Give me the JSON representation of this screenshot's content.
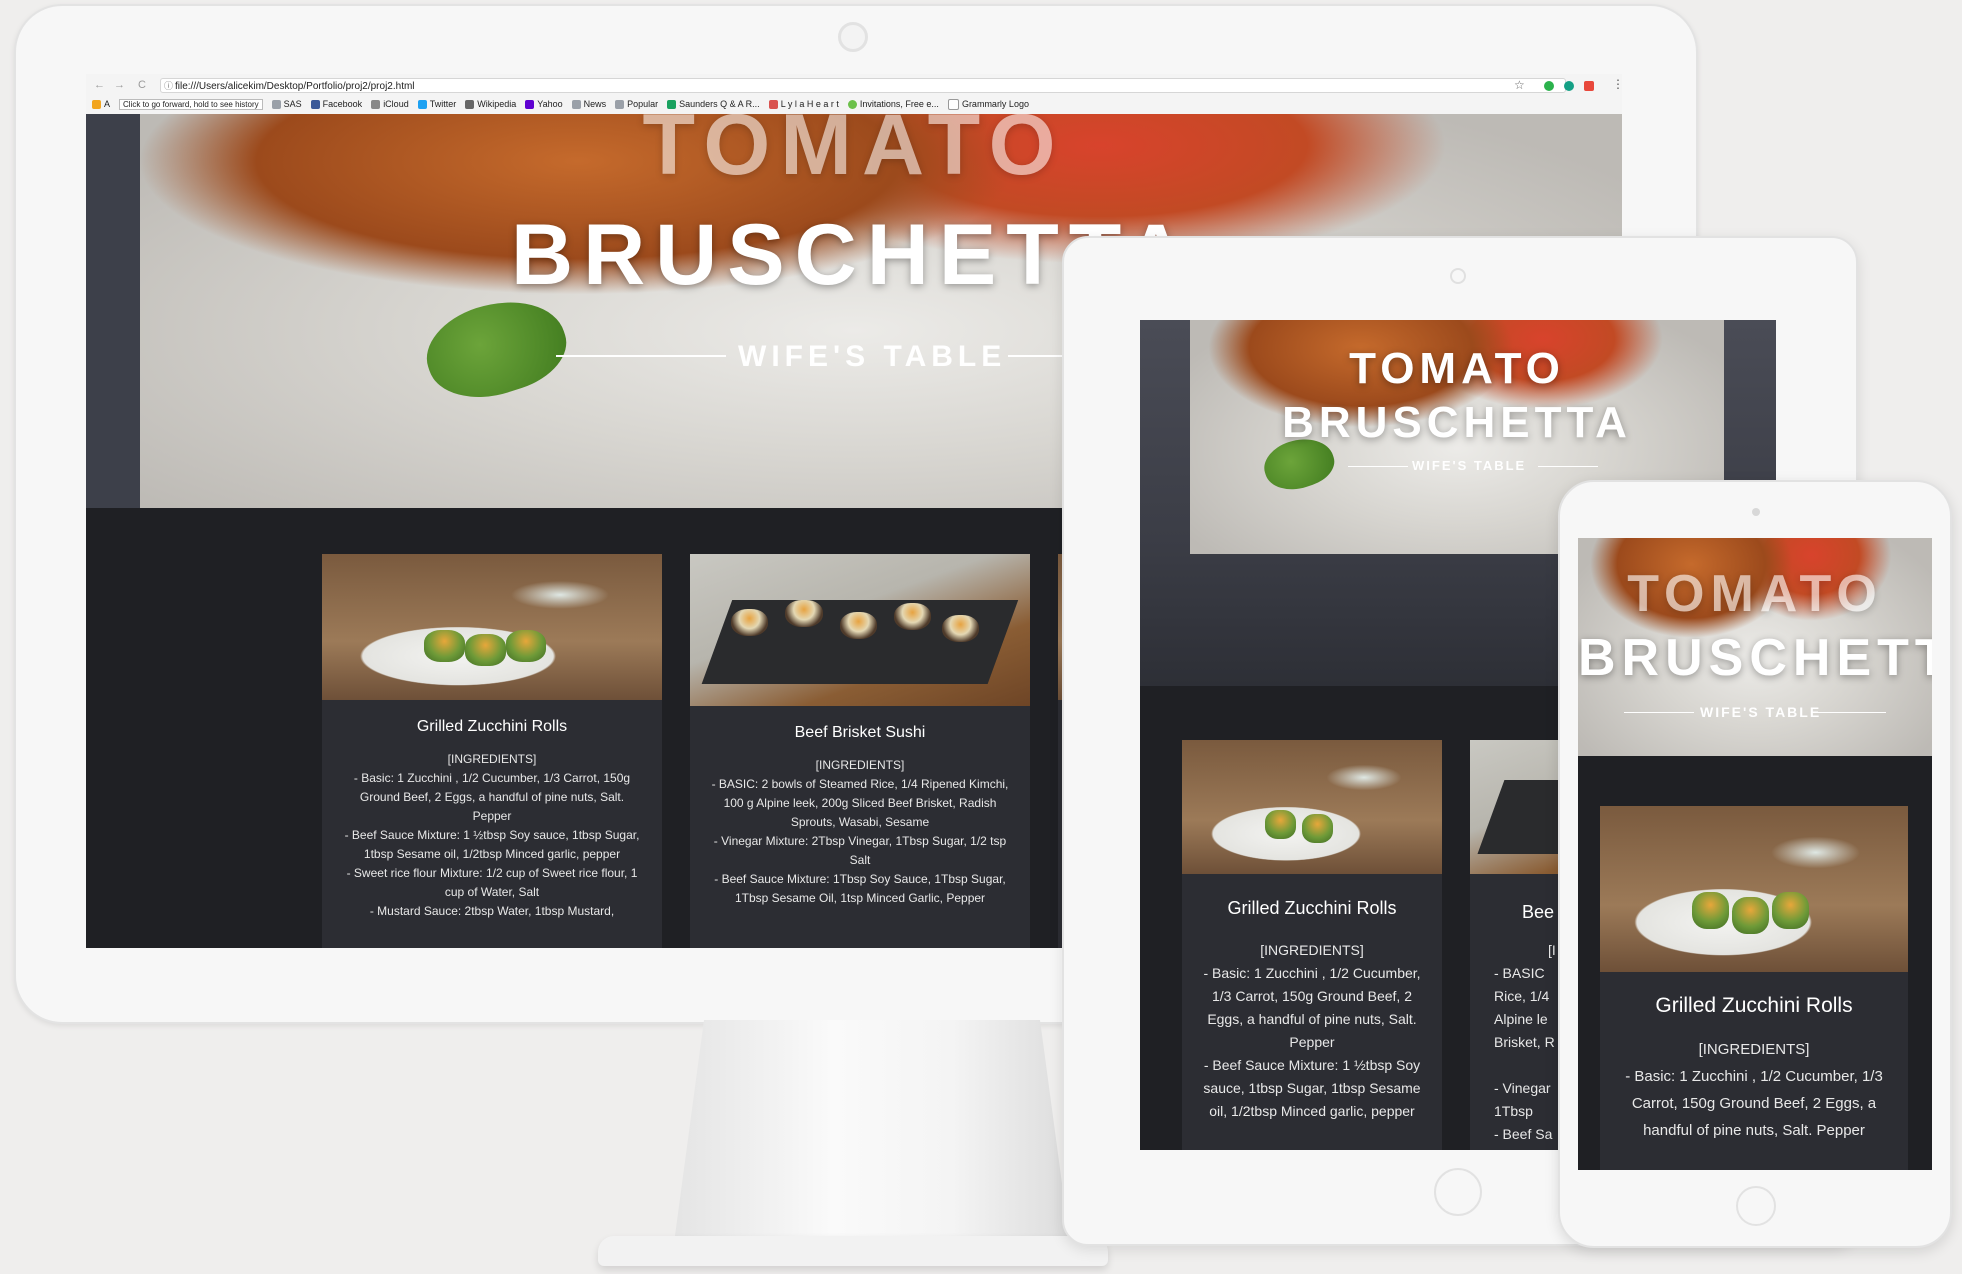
{
  "browser": {
    "url": "file:///Users/alicekim/Desktop/Portfolio/proj2/proj2.html",
    "back_label": "←",
    "forward_label": "→",
    "reload_label": "C",
    "bookmarks": [
      {
        "label": "Click to go forward, hold to see history",
        "color": "#f2a51f"
      },
      {
        "label": "SAS",
        "color": "#9aa0a8"
      },
      {
        "label": "Facebook",
        "color": "#3b5998"
      },
      {
        "label": "iCloud",
        "color": "#888888"
      },
      {
        "label": "Twitter",
        "color": "#1da1f2"
      },
      {
        "label": "Wikipedia",
        "color": "#666666"
      },
      {
        "label": "Yahoo",
        "color": "#5f01d1"
      },
      {
        "label": "News",
        "color": "#9aa0a8"
      },
      {
        "label": "Popular",
        "color": "#9aa0a8"
      },
      {
        "label": "Saunders Q & A R...",
        "color": "#1aa260"
      },
      {
        "label": "L y l a H e a r t",
        "color": "#d9534f"
      },
      {
        "label": "Invitations, Free e...",
        "color": "#6cc04a"
      },
      {
        "label": "Grammarly Logo",
        "color": "#9aa0a8"
      }
    ]
  },
  "hero": {
    "title_line1": "TOMATO",
    "title_line2": "BRUSCHETTA",
    "subtitle": "WIFE'S TABLE"
  },
  "recipes": [
    {
      "title": "Grilled Zucchini Rolls",
      "ingredients_header": "[INGREDIENTS]",
      "lines": [
        "- Basic: 1 Zucchini , 1/2 Cucumber, 1/3 Carrot, 150g Ground Beef, 2 Eggs, a handful of pine nuts, Salt. Pepper",
        "- Beef Sauce Mixture: 1 ½tbsp Soy sauce, 1tbsp Sugar, 1tbsp Sesame oil, 1/2tbsp Minced garlic, pepper",
        "- Sweet rice flour Mixture: 1/2 cup of Sweet rice flour, 1 cup of Water, Salt",
        "- Mustard Sauce: 2tbsp Water, 1tbsp Mustard,"
      ]
    },
    {
      "title": "Beef Brisket Sushi",
      "ingredients_header": "[INGREDIENTS]",
      "lines": [
        "- BASIC: 2 bowls of Steamed Rice, 1/4 Ripened Kimchi, 100 g Alpine leek, 200g Sliced Beef Brisket, Radish Sprouts, Wasabi, Sesame",
        "- Vinegar Mixture: 2Tbsp Vinegar, 1Tbsp Sugar, 1/2 tsp Salt",
        "- Beef Sauce Mixture: 1Tbsp Soy Sauce, 1Tbsp Sugar, 1Tbsp Sesame Oil, 1tsp Minced Garlic, Pepper"
      ]
    }
  ],
  "tablet": {
    "card1_lines": [
      "- Basic: 1 Zucchini , 1/2 Cucumber, 1/3 Carrot, 150g Ground Beef, 2 Eggs, a handful of pine nuts, Salt. Pepper",
      "- Beef Sauce Mixture: 1 ½tbsp Soy sauce, 1tbsp Sugar, 1tbsp Sesame oil, 1/2tbsp Minced garlic, pepper"
    ],
    "card2_title": "Bee",
    "card2_header": "[I",
    "card2_lines": [
      "- BASIC",
      "Rice, 1/4",
      "Alpine le",
      "Brisket, R",
      "",
      "- Vinegar",
      "1Tbsp",
      "- Beef Sa"
    ]
  },
  "phone": {
    "card_lines": [
      "- Basic: 1 Zucchini , 1/2 Cucumber, 1/3 Carrot, 150g Ground Beef, 2 Eggs, a handful of pine nuts, Salt. Pepper"
    ]
  },
  "colors": {
    "page_bg": "#efeeed",
    "site_dark": "#1f2024",
    "card_bg": "#2c2d33"
  }
}
